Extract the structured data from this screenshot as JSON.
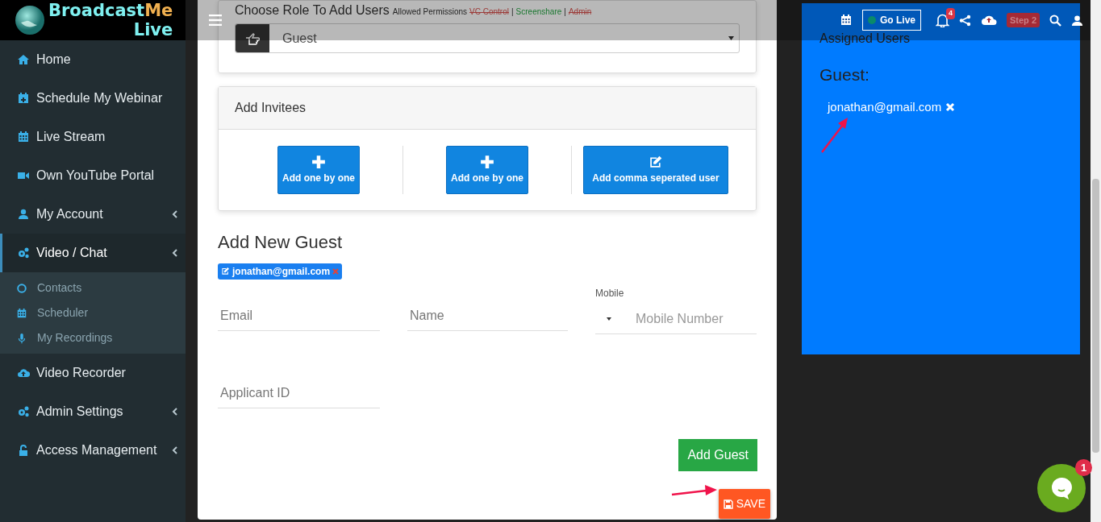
{
  "header": {
    "go_live": "Go Live",
    "notification_count": "4",
    "step_badge": "Step 2"
  },
  "sidebar": {
    "logo": {
      "part1": "Broadcast",
      "part2": "Me",
      "part3": "Live"
    },
    "items": [
      {
        "kind": "home",
        "label": "Home",
        "has_submenu": false,
        "selected": false
      },
      {
        "kind": "calendar-plus",
        "label": "Schedule My Webinar",
        "has_submenu": false,
        "selected": false
      },
      {
        "kind": "calendar",
        "label": "Live Stream",
        "has_submenu": false,
        "selected": false
      },
      {
        "kind": "video",
        "label": "Own YouTube Portal",
        "has_submenu": false,
        "selected": false
      },
      {
        "kind": "user",
        "label": "My Account",
        "has_submenu": true,
        "selected": false
      },
      {
        "kind": "cogs",
        "label": "Video / Chat",
        "has_submenu": true,
        "selected": true,
        "children": [
          {
            "kind": "circle",
            "label": "Contacts"
          },
          {
            "kind": "calendar",
            "label": "Scheduler"
          },
          {
            "kind": "mic",
            "label": "My Recordings"
          }
        ]
      },
      {
        "kind": "cloud-upload",
        "label": "Video Recorder",
        "has_submenu": false,
        "selected": false
      },
      {
        "kind": "cogs",
        "label": "Admin Settings",
        "has_submenu": true,
        "selected": false
      },
      {
        "kind": "lock",
        "label": "Access Management",
        "has_submenu": true,
        "selected": false
      }
    ]
  },
  "role_card": {
    "title": "Choose Role To Add Users",
    "permissions_label": "Allowed Permissions",
    "permissions": [
      {
        "kind": "permission",
        "label": "VC Control",
        "allowed": false
      },
      {
        "kind": "separator",
        "label": "|"
      },
      {
        "kind": "permission",
        "label": "Screenshare",
        "allowed": true
      },
      {
        "kind": "separator",
        "label": "|"
      },
      {
        "kind": "permission",
        "label": "Admin",
        "allowed": false
      }
    ],
    "role": "Guest"
  },
  "invitees": {
    "title": "Add Invitees",
    "buttons": [
      {
        "kind": "plus",
        "label": "Add one by one"
      },
      {
        "kind": "plus",
        "label": "Add one by one"
      },
      {
        "kind": "edit",
        "label": "Add comma seperated user"
      }
    ]
  },
  "new_guest": {
    "title": "Add New Guest",
    "chips": [
      {
        "label": "jonathan@gmail.com"
      }
    ],
    "fields": [
      {
        "kind": "text",
        "placeholder": "Email"
      },
      {
        "kind": "text",
        "placeholder": "Name"
      },
      {
        "kind": "phone",
        "label": "Mobile",
        "placeholder": "Mobile Number"
      },
      {
        "kind": "text",
        "placeholder": "Applicant ID"
      }
    ],
    "add_button": "Add Guest",
    "save_button": "SAVE"
  },
  "assigned": {
    "title": "Assigned Users",
    "groups": [
      {
        "role": "Guest:",
        "users": [
          "jonathan@gmail.com"
        ]
      }
    ]
  },
  "chat": {
    "unread": "1"
  }
}
